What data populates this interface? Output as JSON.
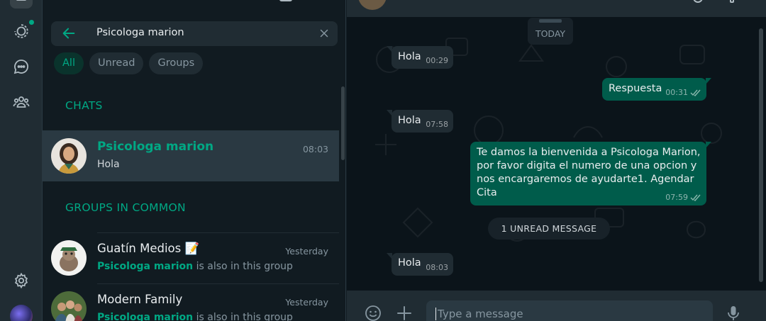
{
  "colors": {
    "accent": "#00a884",
    "outgoing_bubble": "#005c4b",
    "incoming_bubble": "#202c33",
    "panel": "#111b21"
  },
  "rail": {
    "icons": [
      "chats-icon",
      "status-icon",
      "channels-icon",
      "communities-icon",
      "settings-icon"
    ]
  },
  "search": {
    "value": "Psicologa marion"
  },
  "filters": [
    "All",
    "Unread",
    "Groups"
  ],
  "sections": {
    "chats": "CHATS",
    "groups_in_common": "GROUPS IN COMMON"
  },
  "chats": [
    {
      "name": "Psicologa marion",
      "time": "08:03",
      "preview": "Hola"
    }
  ],
  "groups": [
    {
      "name": "Guatín Medios 📝",
      "time": "Yesterday",
      "member": "Psicologa marion",
      "rest": " is also in this group"
    },
    {
      "name": "Modern Family",
      "time": "Yesterday",
      "member": "Psicologa marion",
      "rest": " is also in this group"
    }
  ],
  "conversation": {
    "date_chip": "TODAY",
    "messages": [
      {
        "dir": "in",
        "text": "Hola",
        "time": "00:29"
      },
      {
        "dir": "out",
        "text": "Respuesta",
        "time": "00:31"
      },
      {
        "dir": "in",
        "text": "Hola",
        "time": "07:58"
      },
      {
        "dir": "out",
        "text": "Te damos la bienvenida a Psicologa Marion, por favor digita el numero de una opcion y nos encargaremos de ayudarte1. Agendar Cita",
        "time": "07:59"
      },
      {
        "dir": "in",
        "text": "Hola",
        "time": "08:03"
      }
    ],
    "unread_label": "1 UNREAD MESSAGE",
    "composer_placeholder": "Type a message"
  }
}
